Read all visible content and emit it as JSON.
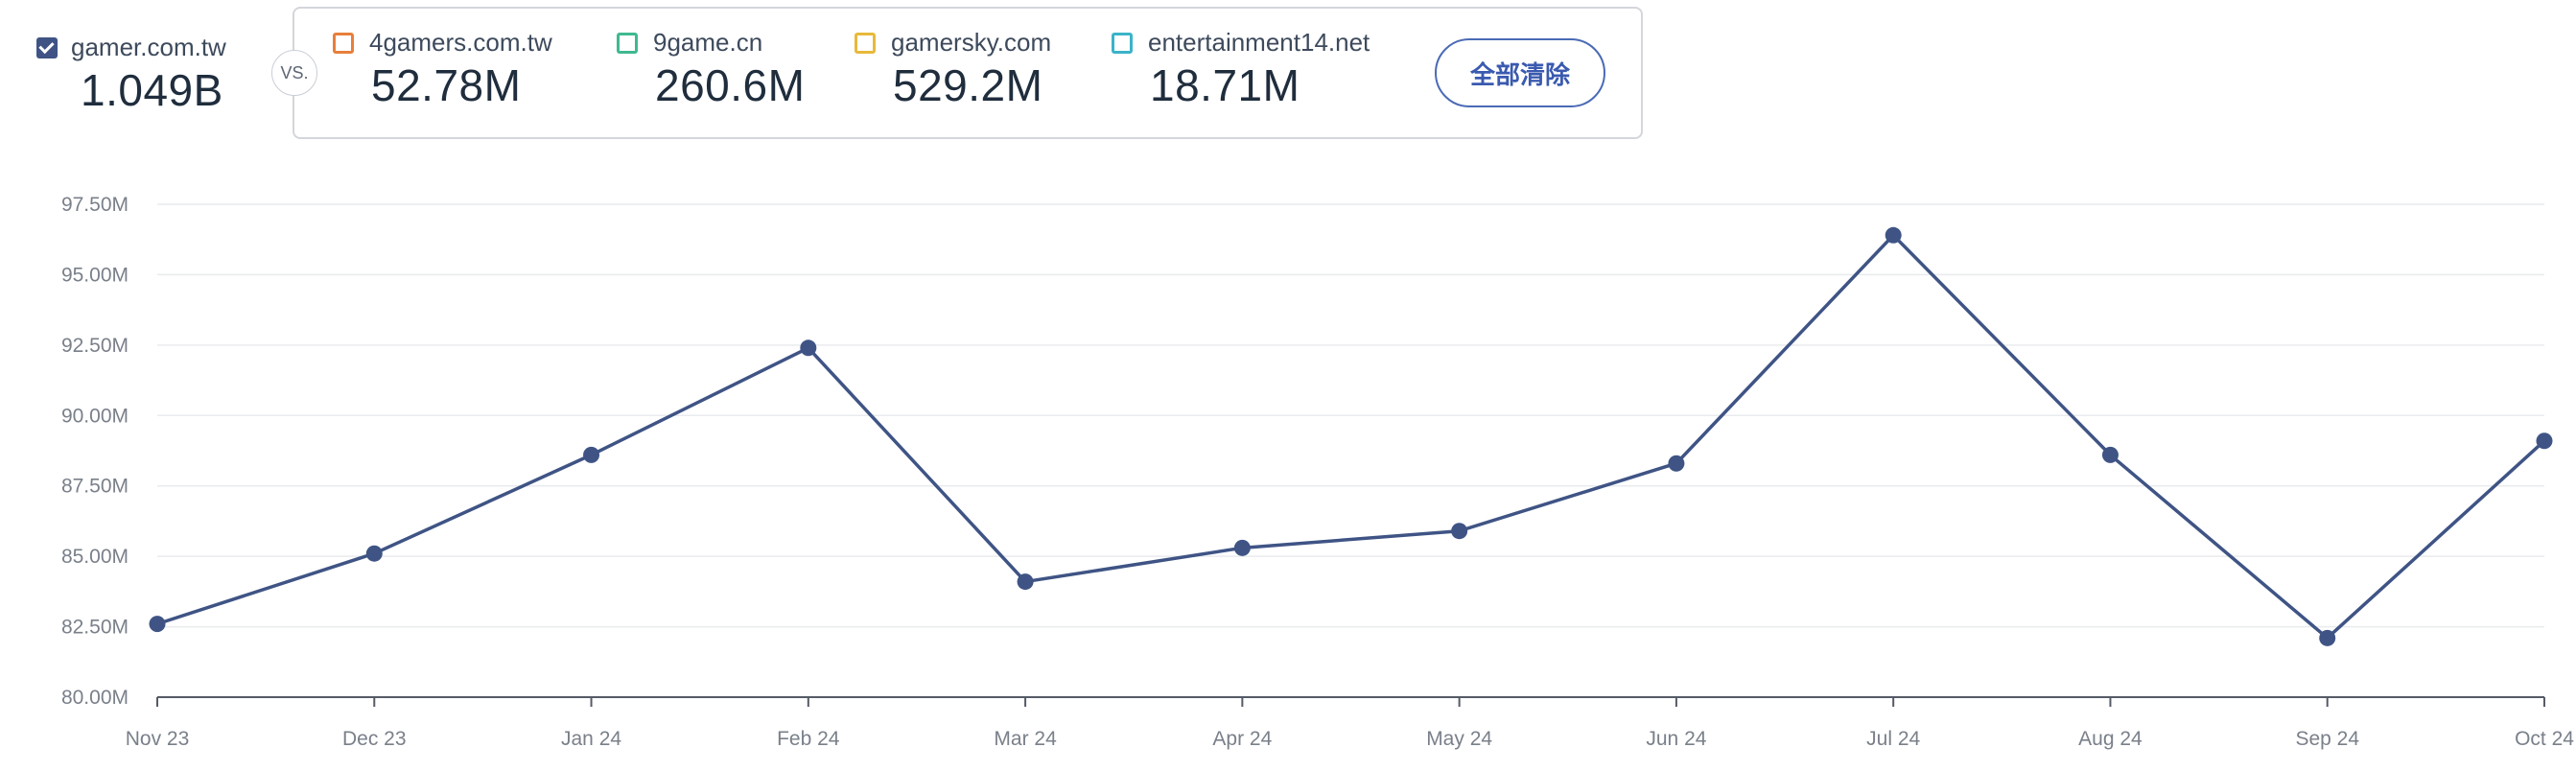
{
  "primary": {
    "site": "gamer.com.tw",
    "total": "1.049B",
    "checked": true,
    "color": "#3f5485"
  },
  "vs_label": "VS.",
  "competitors": [
    {
      "site": "4gamers.com.tw",
      "total": "52.78M",
      "color": "#e87f3a"
    },
    {
      "site": "9game.cn",
      "total": "260.6M",
      "color": "#3fb98f"
    },
    {
      "site": "gamersky.com",
      "total": "529.2M",
      "color": "#e8b93a"
    },
    {
      "site": "entertainment14.net",
      "total": "18.71M",
      "color": "#3ab3c8"
    }
  ],
  "clear_all_label": "全部清除",
  "chart_data": {
    "type": "line",
    "categories": [
      "Nov 23",
      "Dec 23",
      "Jan 24",
      "Feb 24",
      "Mar 24",
      "Apr 24",
      "May 24",
      "Jun 24",
      "Jul 24",
      "Aug 24",
      "Sep 24",
      "Oct 24"
    ],
    "series": [
      {
        "values": [
          82.6,
          85.1,
          88.6,
          92.4,
          84.1,
          85.3,
          85.9,
          88.3,
          96.4,
          88.6,
          82.1,
          89.1
        ],
        "color": "#3f5485"
      }
    ],
    "yticks": [
      "97.50M",
      "95.00M",
      "92.50M",
      "90.00M",
      "87.50M",
      "85.00M",
      "82.50M",
      "80.00M"
    ],
    "ylim": [
      80,
      97.5
    ],
    "grid": true
  }
}
